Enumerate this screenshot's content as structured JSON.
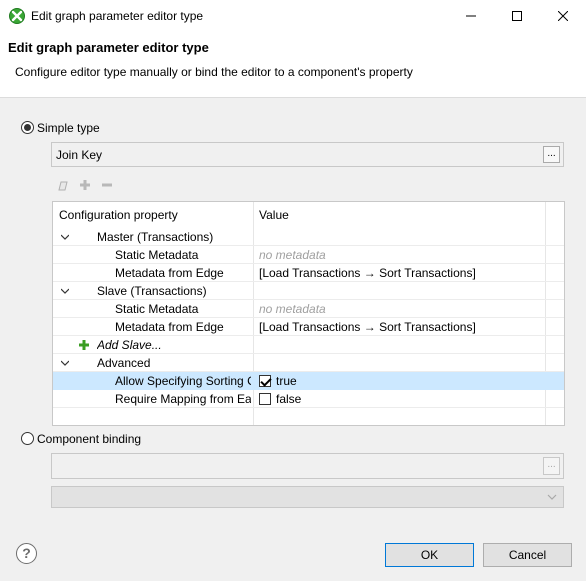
{
  "window": {
    "title": "Edit graph parameter editor type",
    "icons": {
      "app": "cloverdx-icon",
      "minimize": "minimize-icon",
      "maximize": "maximize-icon",
      "close": "close-icon"
    }
  },
  "header": {
    "title": "Edit graph parameter editor type",
    "description": "Configure editor type manually or bind the editor to a component's property"
  },
  "simple_type": {
    "label": "Simple type",
    "selected": true,
    "combo_value": "Join Key",
    "browse_label": "..."
  },
  "table": {
    "columns": [
      "Configuration property",
      "Value"
    ],
    "rows": [
      {
        "type": "group",
        "label": "Master (Transactions)",
        "value": ""
      },
      {
        "type": "child",
        "label": "Static Metadata",
        "value": "no metadata",
        "muted": true
      },
      {
        "type": "child",
        "label": "Metadata from Edge",
        "value": "[Load Transactions → Sort Transactions]"
      },
      {
        "type": "group",
        "label": "Slave (Transactions)",
        "value": ""
      },
      {
        "type": "child",
        "label": "Static Metadata",
        "value": "no metadata",
        "muted": true
      },
      {
        "type": "child",
        "label": "Metadata from Edge",
        "value": "[Load Transactions → Sort Transactions]"
      },
      {
        "type": "add",
        "label": "Add Slave...",
        "value": ""
      },
      {
        "type": "group",
        "label": "Advanced",
        "value": ""
      },
      {
        "type": "check",
        "label": "Allow Specifying Sorting C",
        "value": "true",
        "checked": true,
        "selected": true
      },
      {
        "type": "check",
        "label": "Require Mapping from Ea",
        "value": "false",
        "checked": false
      }
    ]
  },
  "component_binding": {
    "label": "Component binding",
    "selected": false,
    "browse_label": "..."
  },
  "footer": {
    "help_label": "?",
    "ok_label": "OK",
    "cancel_label": "Cancel"
  },
  "colors": {
    "selection": "#cce8ff",
    "accent": "#0078d7",
    "add_green": "#3a9d23"
  }
}
